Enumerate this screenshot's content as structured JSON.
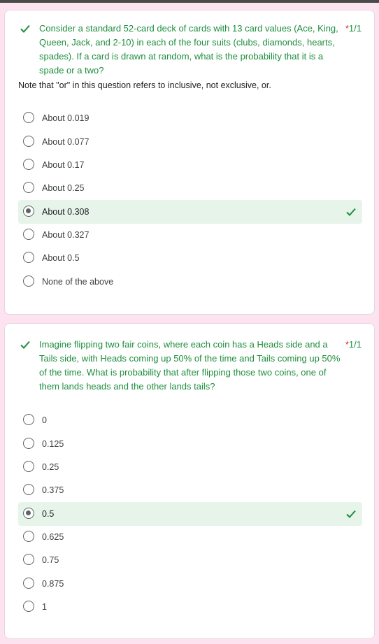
{
  "questions": [
    {
      "text": "Consider a standard 52-card deck of cards with 13 card values (Ace, King, Queen, Jack, and 2-10) in each of the four suits (clubs, diamonds, hearts, spades). If a card is drawn at random, what is the probability that it is a spade or a two?",
      "required_mark": "*",
      "score": "1/1",
      "note": "Note that \"or\" in this question refers to inclusive, not exclusive, or.",
      "options": [
        "About 0.019",
        "About 0.077",
        "About 0.17",
        "About 0.25",
        "About 0.308",
        "About 0.327",
        "About 0.5",
        "None of the above"
      ],
      "selected": "About 0.308"
    },
    {
      "text": "Imagine flipping two fair coins, where each coin has a Heads side and a Tails side, with Heads coming up 50% of the time and Tails coming up 50% of the time. What is probability that after flipping those two coins, one of them lands heads and the other lands tails?",
      "required_mark": "*",
      "score": "1/1",
      "options": [
        "0",
        "0.125",
        "0.25",
        "0.375",
        "0.5",
        "0.625",
        "0.75",
        "0.875",
        "1"
      ],
      "selected": "0.5"
    }
  ],
  "colors": {
    "correct": "#1e8e3e",
    "correct_bg": "#e6f4ea",
    "required": "#d93025",
    "page_bg": "#fde3ef"
  },
  "icons": {
    "question_status": "check-icon",
    "correct_option": "check-icon",
    "radio": "radio-icon"
  }
}
